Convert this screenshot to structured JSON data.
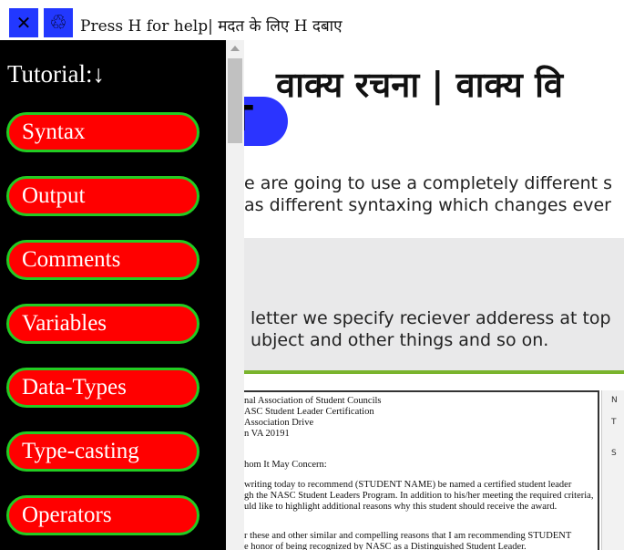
{
  "topbar": {
    "close_icon": "✕",
    "recycle_icon": "♲",
    "help_text": "Press H for help| मदत के लिए H दबाए"
  },
  "sidebar": {
    "title": "Tutorial:↓",
    "items": [
      {
        "label": "Syntax"
      },
      {
        "label": "Output"
      },
      {
        "label": "Comments"
      },
      {
        "label": "Variables"
      },
      {
        "label": "Data-Types"
      },
      {
        "label": "Type-casting"
      },
      {
        "label": "Operators"
      }
    ]
  },
  "main": {
    "heading": "वाक्य रचना |  वाक्य वि",
    "badge_letter": "T",
    "para1_line1": "e are going to use a completely different s",
    "para1_line2": "as different syntaxing which changes ever",
    "para2_line1": "letter we specify reciever adderess at top",
    "para2_line2": "ubject and other things and so on."
  },
  "letter_image": {
    "lines": [
      "nal Association of Student Councils",
      "ASC Student Leader Certification",
      " Association Drive",
      "n VA 20191",
      "hom It May Concern:",
      "writing today to recommend (STUDENT NAME) be named a certified student leader",
      "gh the NASC Student Leaders Program.  In addition to his/her meeting the required criteria,",
      "uld like to highlight additional reasons why this student should receive the award.",
      "r these and other similar and compelling reasons that I am recommending STUDENT",
      "e honor of being recognized by NASC as a Distinguished Student Leader."
    ],
    "side_letters": [
      "N",
      "T",
      "S"
    ]
  },
  "colors": {
    "sidebar_bg": "#000000",
    "nav_item_bg": "#ff0000",
    "nav_item_border": "#22cc22",
    "topbar_button": "#2238ff",
    "badge": "#2b34ff",
    "rule": "#7ab42d"
  }
}
